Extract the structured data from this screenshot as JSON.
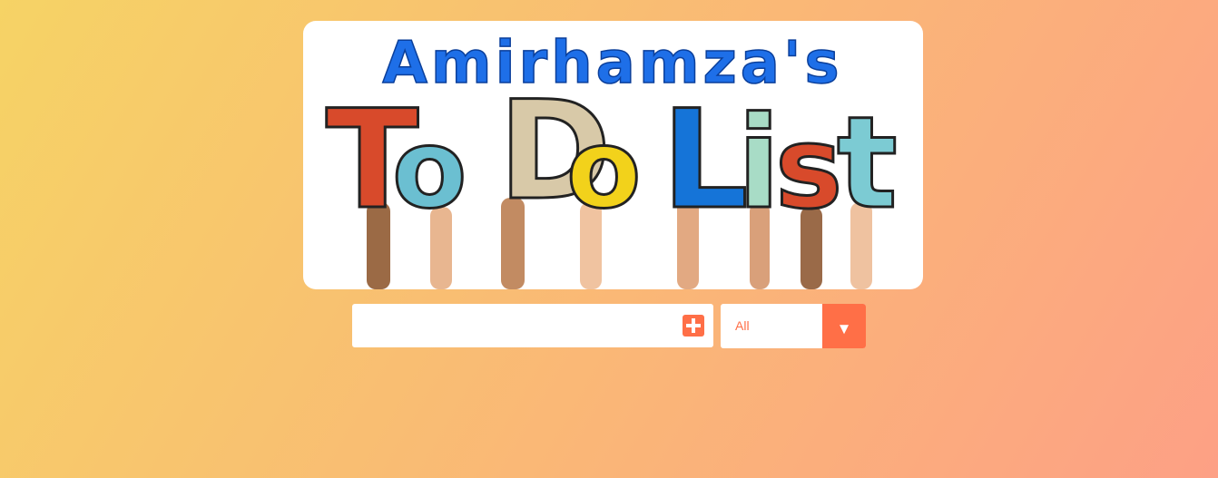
{
  "banner": {
    "line1": "Amirhamza's",
    "letters": [
      "T",
      "o",
      "D",
      "o",
      "L",
      "i",
      "s",
      "t"
    ],
    "title_color": "#1e6fe8"
  },
  "form": {
    "input_value": "",
    "input_placeholder": "",
    "add_icon": "plus-square-icon",
    "filter": {
      "selected": "All",
      "arrow_glyph": "▼"
    }
  },
  "colors": {
    "accent": "#ff6f47",
    "gradient_start": "#f6d365",
    "gradient_end": "#fda085"
  }
}
